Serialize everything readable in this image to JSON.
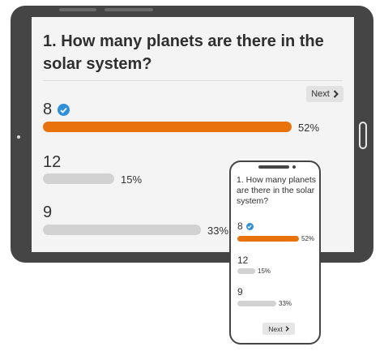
{
  "tablet": {
    "question": "1. How many planets are there in the solar system?",
    "next_label": "Next",
    "options": [
      {
        "label": "8",
        "percent_text": "52%",
        "percent": 52,
        "correct": true
      },
      {
        "label": "12",
        "percent_text": "15%",
        "percent": 15,
        "correct": false
      },
      {
        "label": "9",
        "percent_text": "33%",
        "percent": 33,
        "correct": false
      }
    ]
  },
  "phone": {
    "question": "1. How many planets are there in the solar system?",
    "next_label": "Next",
    "options": [
      {
        "label": "8",
        "percent_text": "52%",
        "percent": 52,
        "correct": true
      },
      {
        "label": "12",
        "percent_text": "15%",
        "percent": 15,
        "correct": false
      },
      {
        "label": "9",
        "percent_text": "33%",
        "percent": 33,
        "correct": false
      }
    ]
  },
  "colors": {
    "bar_correct": "#e8720c",
    "bar_other": "#d2d2d2",
    "check": "#2f8fd8",
    "device_frame": "#454545"
  },
  "icons": {
    "check": "check-circle-icon",
    "next": "chevron-right-icon"
  }
}
